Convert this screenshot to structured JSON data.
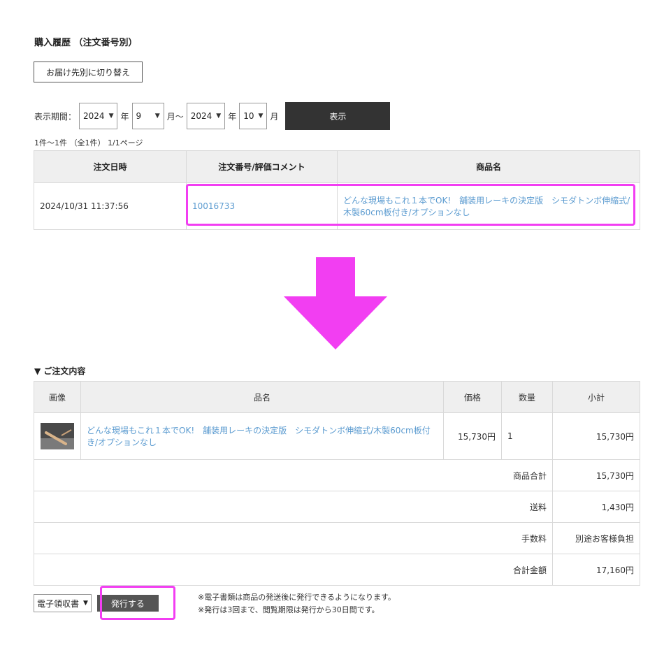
{
  "page_title": "購入履歴 （注文番号別）",
  "switch_button": "お届け先別に切り替え",
  "period": {
    "label": "表示期間：",
    "from_year": "2024",
    "year_unit": "年",
    "from_month": "9",
    "month_range_unit": "月～",
    "to_year": "2024",
    "to_month": "10",
    "month_unit": "月",
    "show_button": "表示"
  },
  "result_count": "1件～1件 （全1件） 1/1ページ",
  "history_table": {
    "headers": [
      "注文日時",
      "注文番号/評価コメント",
      "商品名"
    ],
    "rows": [
      {
        "datetime": "2024/10/31 11:37:56",
        "order_number": "10016733",
        "product_name": "どんな現場もこれ１本でOK!　舗装用レーキの決定版　シモダトンボ伸縮式/木製60cm板付き/オプションなし"
      }
    ]
  },
  "order_section_title": "▼ ご注文内容",
  "order_table": {
    "headers": [
      "画像",
      "品名",
      "価格",
      "数量",
      "小計"
    ],
    "item": {
      "image_icon": "rake-product-thumbnail",
      "name": "どんな現場もこれ１本でOK!　舗装用レーキの決定版　シモダトンボ伸縮式/木製60cm板付き/オプションなし",
      "price": "15,730円",
      "quantity": "1",
      "subtotal": "15,730円"
    },
    "summary": [
      {
        "label": "商品合計",
        "value": "15,730円"
      },
      {
        "label": "送料",
        "value": "1,430円"
      },
      {
        "label": "手数料",
        "value": "別途お客様負担"
      },
      {
        "label": "合計金額",
        "value": "17,160円"
      }
    ]
  },
  "receipt": {
    "select_value": "電子領収書",
    "issue_button": "発行する",
    "notes": [
      "※電子書類は商品の発送後に発行できるようになります。",
      "※発行は3回まで、閲覧期限は発行から30日間です。"
    ]
  },
  "colors": {
    "highlight": "#f23ef2",
    "link": "#5b9bd0",
    "dark_button": "#333333",
    "header_bg": "#efefef"
  }
}
